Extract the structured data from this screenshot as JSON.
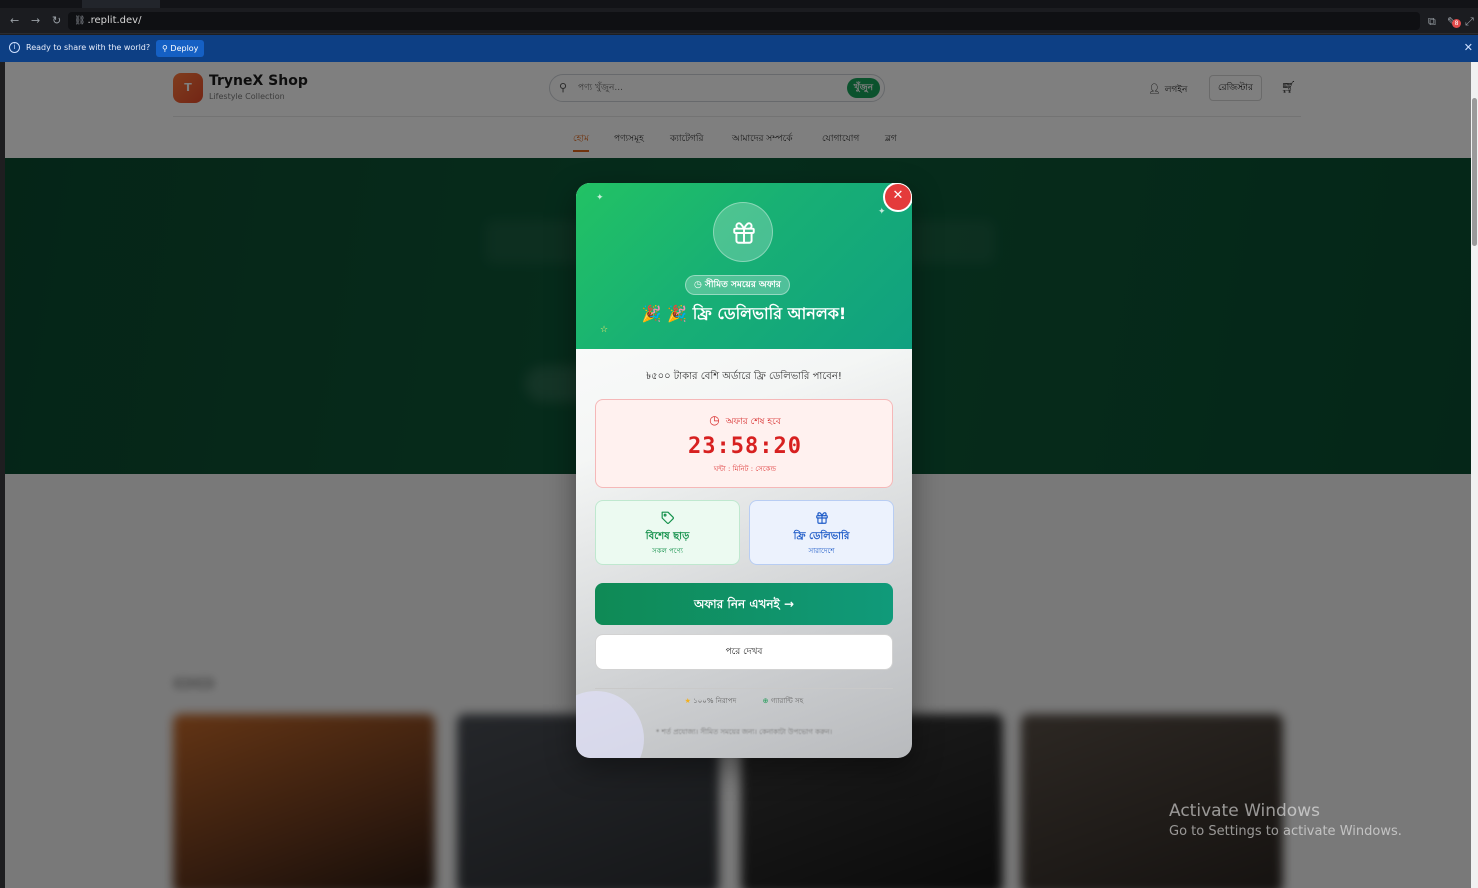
{
  "browser": {
    "url": ".replit.dev/",
    "notification_count": "8"
  },
  "infobar": {
    "message": "Ready to share with the world?",
    "deploy_label": "Deploy"
  },
  "site": {
    "brand_initial": "T",
    "brand_name": "TryneX Shop",
    "brand_tagline": "Lifestyle Collection",
    "search_placeholder": "পণ্য খুঁজুন...",
    "search_button": "খুঁজুন",
    "login_label": "লগইন",
    "register_label": "রেজিস্টার",
    "nav": [
      "হোম",
      "পণ্যসমূহ",
      "ক্যাটেগরি",
      "আমাদের সম্পর্কে",
      "যোগাযোগ",
      "ব্লগ"
    ]
  },
  "modal": {
    "badge_label": "সীমিত সময়ের অফার",
    "headline": "🎉 🎉 ফ্রি ডেলিভারি আনলক!",
    "subtitle": "৳৫০০ টাকার বেশি অর্ডারে ফ্রি ডেলিভারি পাবেন!",
    "timer_title": "অফার শেষ হবে",
    "timer_value": "23:58:20",
    "timer_units": "ঘন্টা : মিনিট : সেকেন্ড",
    "feature_discount_title": "বিশেষ ছাড়",
    "feature_discount_sub": "সকল পণ্যে",
    "feature_delivery_title": "ফ্রি ডেলিভারি",
    "feature_delivery_sub": "সারাদেশে",
    "cta_label": "অফার নিন এখনই",
    "later_label": "পরে দেখব",
    "secure_label": "১০০% নিরাপদ",
    "guarantee_label": "গ্যারান্টি সহ",
    "footnote": "* শর্ত প্রযোজ্য। সীমিত সময়ের জন্য। কেনাকাটা উপভোগ করুন।"
  },
  "windows": {
    "activate_title": "Activate Windows",
    "activate_sub": "Go to Settings to activate Windows."
  },
  "colors": {
    "brand_orange": "#e64b2a",
    "accent_green": "#16a45a",
    "timer_red": "#d72020",
    "infobar_blue": "#0d3f84"
  }
}
